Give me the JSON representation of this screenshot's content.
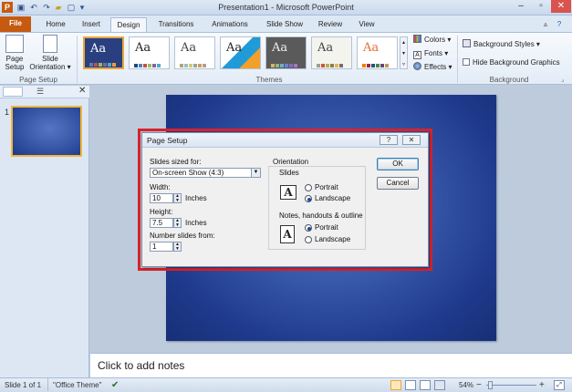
{
  "app": {
    "title": "Presentation1  -  Microsoft PowerPoint"
  },
  "quick_access": {
    "icons": [
      "powerpoint-logo-icon",
      "save-icon",
      "undo-icon",
      "redo-icon",
      "open-icon",
      "new-icon",
      "customize-icon"
    ]
  },
  "tabs": [
    {
      "label": "File"
    },
    {
      "label": "Home"
    },
    {
      "label": "Insert"
    },
    {
      "label": "Design"
    },
    {
      "label": "Transitions"
    },
    {
      "label": "Animations"
    },
    {
      "label": "Slide Show"
    },
    {
      "label": "Review"
    },
    {
      "label": "View"
    }
  ],
  "active_tab": "Design",
  "ribbon": {
    "page_setup_group": {
      "label": "Page Setup",
      "page_setup_btn": "Page\nSetup",
      "orientation_btn": "Slide\nOrientation ▾"
    },
    "themes_group": {
      "label": "Themes",
      "colors": "Colors ▾",
      "fonts": "Fonts ▾",
      "effects": "Effects ▾",
      "theme_text": "Aa"
    },
    "background_group": {
      "label": "Background",
      "styles": "Background Styles ▾",
      "hide": "Hide Background Graphics"
    }
  },
  "thumbnail": {
    "number": "1"
  },
  "notes": {
    "placeholder": "Click to add notes"
  },
  "status": {
    "slide": "Slide 1 of 1",
    "theme": "\"Office Theme\"",
    "zoom": "54%"
  },
  "dialog": {
    "title": "Page Setup",
    "help": "?",
    "close": "✕",
    "slides_sized_for_label": "Slides sized for:",
    "slides_sized_for_value": "On-screen Show (4:3)",
    "width_label": "Width:",
    "width_value": "10",
    "width_unit": "Inches",
    "height_label": "Height:",
    "height_value": "7.5",
    "height_unit": "Inches",
    "number_from_label": "Number slides from:",
    "number_from_value": "1",
    "orientation_label": "Orientation",
    "slides_label": "Slides",
    "notes_label": "Notes, handouts & outline",
    "portrait": "Portrait",
    "landscape": "Landscape",
    "icon_letter": "A",
    "ok": "OK",
    "cancel": "Cancel"
  }
}
